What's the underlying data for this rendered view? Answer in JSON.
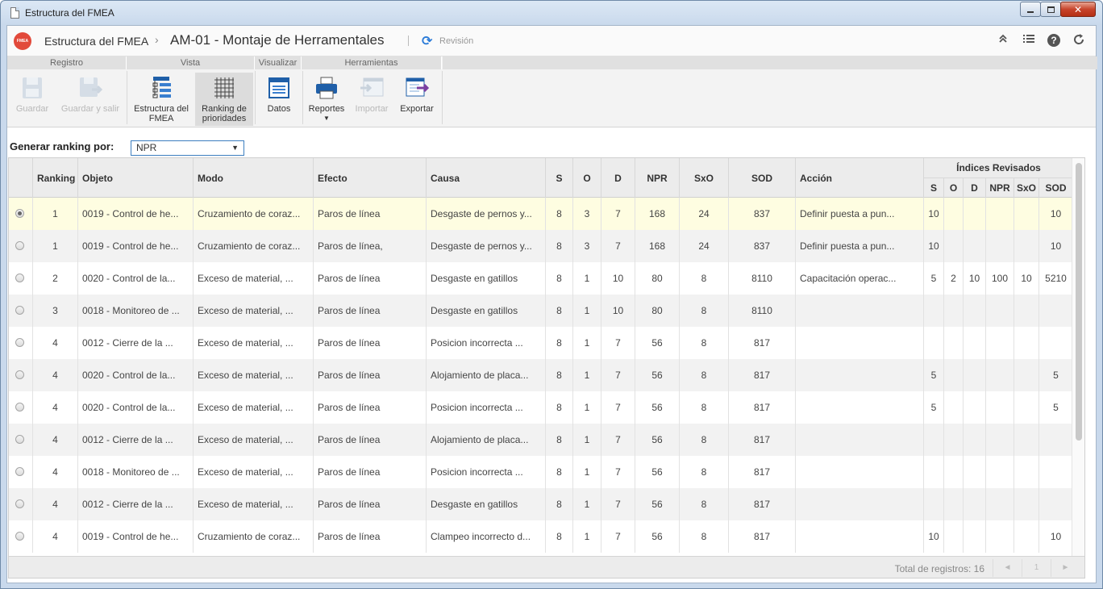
{
  "window": {
    "title": "Estructura del FMEA"
  },
  "header": {
    "logo_text": "FMEA",
    "breadcrumb_root": "Estructura del FMEA",
    "breadcrumb_sep": "›",
    "page_title": "AM-01 - Montaje de Herramentales",
    "revision_label": "Revisión"
  },
  "ribbon": {
    "groups": [
      "Registro",
      "Vista",
      "Visualizar",
      "Herramientas"
    ],
    "buttons": {
      "guardar": "Guardar",
      "guardar_salir": "Guardar y salir",
      "estructura": "Estructura del FMEA",
      "ranking": "Ranking de prioridades",
      "datos": "Datos",
      "reportes": "Reportes",
      "importar": "Importar",
      "exportar": "Exportar"
    }
  },
  "filter": {
    "label": "Generar ranking por:",
    "value": "NPR"
  },
  "table": {
    "headers": {
      "ranking": "Ranking",
      "objeto": "Objeto",
      "modo": "Modo",
      "efecto": "Efecto",
      "causa": "Causa",
      "s": "S",
      "o": "O",
      "d": "D",
      "npr": "NPR",
      "sxo": "SxO",
      "sod": "SOD",
      "accion": "Acción",
      "indices": "Índices Revisados",
      "r_s": "S",
      "r_o": "O",
      "r_d": "D",
      "r_npr": "NPR",
      "r_sxo": "SxO",
      "r_sod": "SOD"
    },
    "rows": [
      {
        "selected": true,
        "ranking": "1",
        "objeto": "0019 - Control de he...",
        "modo": "Cruzamiento de coraz...",
        "efecto": "Paros de línea",
        "causa": "Desgaste de pernos y...",
        "s": "8",
        "o": "3",
        "d": "7",
        "npr": "168",
        "sxo": "24",
        "sod": "837",
        "accion": "Definir puesta a pun...",
        "r_s": "10",
        "r_o": "",
        "r_d": "",
        "r_npr": "",
        "r_sxo": "",
        "r_sod": "10"
      },
      {
        "selected": false,
        "ranking": "1",
        "objeto": "0019 - Control de he...",
        "modo": "Cruzamiento de coraz...",
        "efecto": "Paros de línea,",
        "causa": "Desgaste de pernos y...",
        "s": "8",
        "o": "3",
        "d": "7",
        "npr": "168",
        "sxo": "24",
        "sod": "837",
        "accion": "Definir puesta a pun...",
        "r_s": "10",
        "r_o": "",
        "r_d": "",
        "r_npr": "",
        "r_sxo": "",
        "r_sod": "10"
      },
      {
        "selected": false,
        "ranking": "2",
        "objeto": "0020 - Control de la...",
        "modo": "Exceso de material, ...",
        "efecto": "Paros de línea",
        "causa": "Desgaste en gatillos",
        "s": "8",
        "o": "1",
        "d": "10",
        "npr": "80",
        "sxo": "8",
        "sod": "8110",
        "accion": "Capacitación operac...",
        "r_s": "5",
        "r_o": "2",
        "r_d": "10",
        "r_npr": "100",
        "r_sxo": "10",
        "r_sod": "5210"
      },
      {
        "selected": false,
        "ranking": "3",
        "objeto": "0018 - Monitoreo de ...",
        "modo": "Exceso de material, ...",
        "efecto": "Paros de línea",
        "causa": "Desgaste en gatillos",
        "s": "8",
        "o": "1",
        "d": "10",
        "npr": "80",
        "sxo": "8",
        "sod": "8110",
        "accion": "",
        "r_s": "",
        "r_o": "",
        "r_d": "",
        "r_npr": "",
        "r_sxo": "",
        "r_sod": ""
      },
      {
        "selected": false,
        "ranking": "4",
        "objeto": "0012 - Cierre de la ...",
        "modo": "Exceso de material, ...",
        "efecto": "Paros de línea",
        "causa": "Posicion incorrecta ...",
        "s": "8",
        "o": "1",
        "d": "7",
        "npr": "56",
        "sxo": "8",
        "sod": "817",
        "accion": "",
        "r_s": "",
        "r_o": "",
        "r_d": "",
        "r_npr": "",
        "r_sxo": "",
        "r_sod": ""
      },
      {
        "selected": false,
        "ranking": "4",
        "objeto": "0020 - Control de la...",
        "modo": "Exceso de material, ...",
        "efecto": "Paros de línea",
        "causa": "Alojamiento de placa...",
        "s": "8",
        "o": "1",
        "d": "7",
        "npr": "56",
        "sxo": "8",
        "sod": "817",
        "accion": "",
        "r_s": "5",
        "r_o": "",
        "r_d": "",
        "r_npr": "",
        "r_sxo": "",
        "r_sod": "5"
      },
      {
        "selected": false,
        "ranking": "4",
        "objeto": "0020 - Control de la...",
        "modo": "Exceso de material, ...",
        "efecto": "Paros de línea",
        "causa": "Posicion incorrecta ...",
        "s": "8",
        "o": "1",
        "d": "7",
        "npr": "56",
        "sxo": "8",
        "sod": "817",
        "accion": "",
        "r_s": "5",
        "r_o": "",
        "r_d": "",
        "r_npr": "",
        "r_sxo": "",
        "r_sod": "5"
      },
      {
        "selected": false,
        "ranking": "4",
        "objeto": "0012 - Cierre de la ...",
        "modo": "Exceso de material, ...",
        "efecto": "Paros de línea",
        "causa": "Alojamiento de placa...",
        "s": "8",
        "o": "1",
        "d": "7",
        "npr": "56",
        "sxo": "8",
        "sod": "817",
        "accion": "",
        "r_s": "",
        "r_o": "",
        "r_d": "",
        "r_npr": "",
        "r_sxo": "",
        "r_sod": ""
      },
      {
        "selected": false,
        "ranking": "4",
        "objeto": "0018 - Monitoreo de ...",
        "modo": "Exceso de material, ...",
        "efecto": "Paros de línea",
        "causa": "Posicion incorrecta ...",
        "s": "8",
        "o": "1",
        "d": "7",
        "npr": "56",
        "sxo": "8",
        "sod": "817",
        "accion": "",
        "r_s": "",
        "r_o": "",
        "r_d": "",
        "r_npr": "",
        "r_sxo": "",
        "r_sod": ""
      },
      {
        "selected": false,
        "ranking": "4",
        "objeto": "0012 - Cierre de la ...",
        "modo": "Exceso de material, ...",
        "efecto": "Paros de línea",
        "causa": "Desgaste en gatillos",
        "s": "8",
        "o": "1",
        "d": "7",
        "npr": "56",
        "sxo": "8",
        "sod": "817",
        "accion": "",
        "r_s": "",
        "r_o": "",
        "r_d": "",
        "r_npr": "",
        "r_sxo": "",
        "r_sod": ""
      },
      {
        "selected": false,
        "ranking": "4",
        "objeto": "0019 - Control de he...",
        "modo": "Cruzamiento de coraz...",
        "efecto": "Paros de línea",
        "causa": "Clampeo incorrecto d...",
        "s": "8",
        "o": "1",
        "d": "7",
        "npr": "56",
        "sxo": "8",
        "sod": "817",
        "accion": "",
        "r_s": "10",
        "r_o": "",
        "r_d": "",
        "r_npr": "",
        "r_sxo": "",
        "r_sod": "10"
      }
    ]
  },
  "footer": {
    "total": "Total de registros: 16",
    "page": "1",
    "prev": "◄",
    "next": "►"
  },
  "icons": {
    "help": "?",
    "collapse": "≈",
    "list": "☰",
    "refresh": "↻"
  }
}
